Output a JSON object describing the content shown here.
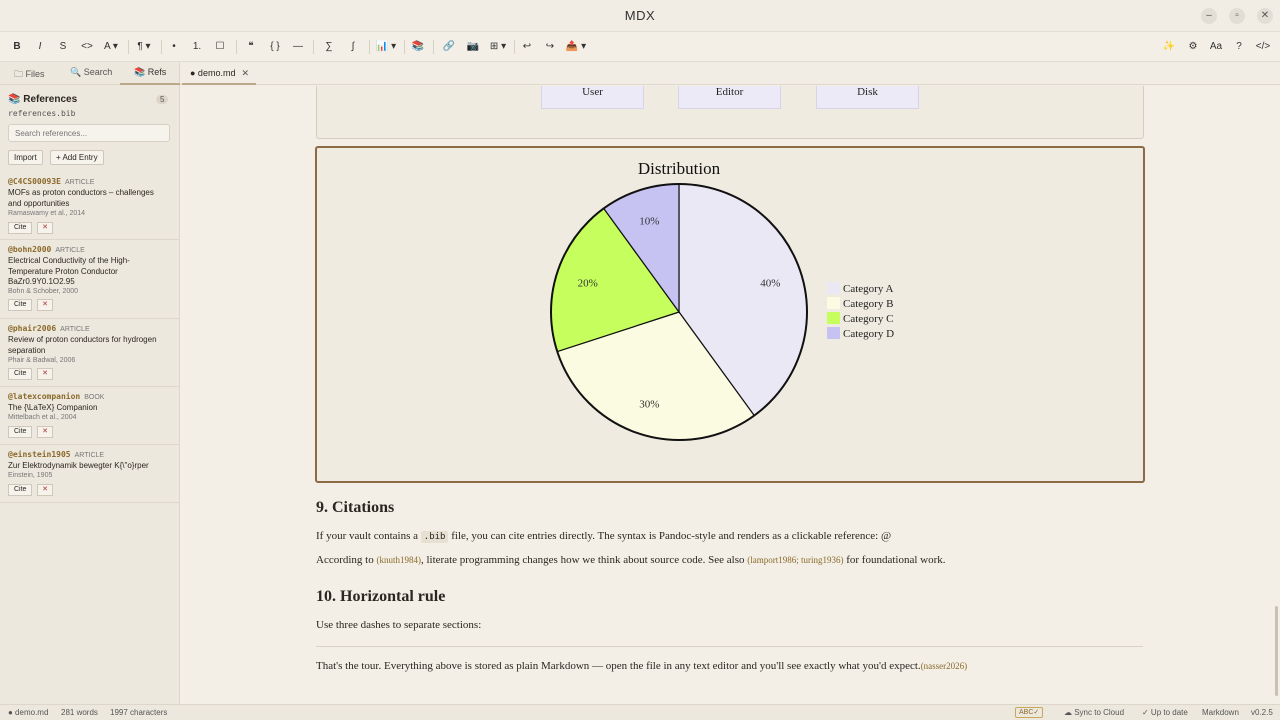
{
  "window": {
    "title": "MDX",
    "controls": [
      "–",
      "▫",
      "✕"
    ]
  },
  "toolbar": {
    "bold": "B",
    "italic": "I",
    "strike": "S",
    "code": "<>",
    "textcolor": "A ▾",
    "paragraph": "¶ ▾",
    "bullet": "•",
    "numbered": "1.",
    "checkbox": "☐",
    "quote": "❝",
    "codeblock": "{ }",
    "hr": "—",
    "sum": "∑",
    "integral": "∫",
    "chart": "📊 ▾",
    "refs": "📚",
    "link": "🔗",
    "image": "📷",
    "table": "⊞ ▾",
    "undo": "↩",
    "redo": "↪",
    "export": "📤 ▾",
    "ai": "✨",
    "settings": "⚙",
    "font": "Aa",
    "help": "?",
    "source": "</>"
  },
  "sidebar": {
    "tabs": [
      {
        "label": "🗀 Files"
      },
      {
        "label": "🔍 Search"
      },
      {
        "label": "📚 Refs"
      }
    ],
    "references_title": "📚 References",
    "count": "5",
    "bib_file": "references.bib",
    "search_placeholder": "Search references...",
    "import_label": "Import",
    "add_label": "+ Add Entry",
    "cite_label": "Cite",
    "delete_label": "✕",
    "entries": [
      {
        "key": "@C4CS00093E",
        "kind": "ARTICLE",
        "title": "MOFs as proton conductors – challenges and opportunities",
        "authors": "Ramaswamy et al., 2014"
      },
      {
        "key": "@bohn2000",
        "kind": "ARTICLE",
        "title": "Electrical Conductivity of the High-Temperature Proton Conductor BaZr0.9Y0.1O2.95",
        "authors": "Bohn & Schober, 2000"
      },
      {
        "key": "@phair2006",
        "kind": "ARTICLE",
        "title": "Review of proton conductors for hydrogen separation",
        "authors": "Phair & Badwal, 2006"
      },
      {
        "key": "@latexcompanion",
        "kind": "BOOK",
        "title": "The {\\LaTeX} Companion",
        "authors": "Mittelbach et al., 2004"
      },
      {
        "key": "@einstein1905",
        "kind": "ARTICLE",
        "title": "Zur Elektrodynamik bewegter K{\\\"o}rper",
        "authors": "Einstein, 1905"
      }
    ]
  },
  "editor_tab": {
    "label": "● demo.md",
    "close": "✕"
  },
  "diagram": {
    "nodes": [
      "User",
      "Editor",
      "Disk"
    ]
  },
  "chart_data": {
    "type": "pie",
    "title": "Distribution",
    "categories": [
      "Category A",
      "Category B",
      "Category C",
      "Category D"
    ],
    "values": [
      40,
      30,
      20,
      10
    ],
    "labels": [
      "40%",
      "30%",
      "20%",
      "10%"
    ],
    "colors": [
      "#ebe8f5",
      "#fbfbe1",
      "#c6ff5d",
      "#c6c2f2"
    ],
    "legend_position": "right"
  },
  "content": {
    "h_citations": "9. Citations",
    "p1_before": "If your vault contains a ",
    "p1_code": ".bib",
    "p1_after": " file, you can cite entries directly. The syntax is Pandoc-style and renders as a clickable reference: @",
    "p2_before": "According to ",
    "p2_cite1": "(knuth1984)",
    "p2_mid": ", literate programming changes how we think about source code. See also ",
    "p2_cite2": "(lamport1986; turing1936)",
    "p2_after": " for foundational work.",
    "h_rule": "10. Horizontal rule",
    "p3": "Use three dashes to separate sections:",
    "p4": "That's the tour. Everything above is stored as plain Markdown — open the file in any text editor and you'll see exactly what you'd expect.",
    "p4_cite": "(nasser2026)"
  },
  "status": {
    "file": "● demo.md",
    "words": "281 words",
    "chars": "1997 characters",
    "spell": "ABC✓",
    "sync": "☁ Sync to Cloud",
    "uptodate": "✓ Up to date",
    "mode": "Markdown",
    "version": "v0.2.5"
  }
}
